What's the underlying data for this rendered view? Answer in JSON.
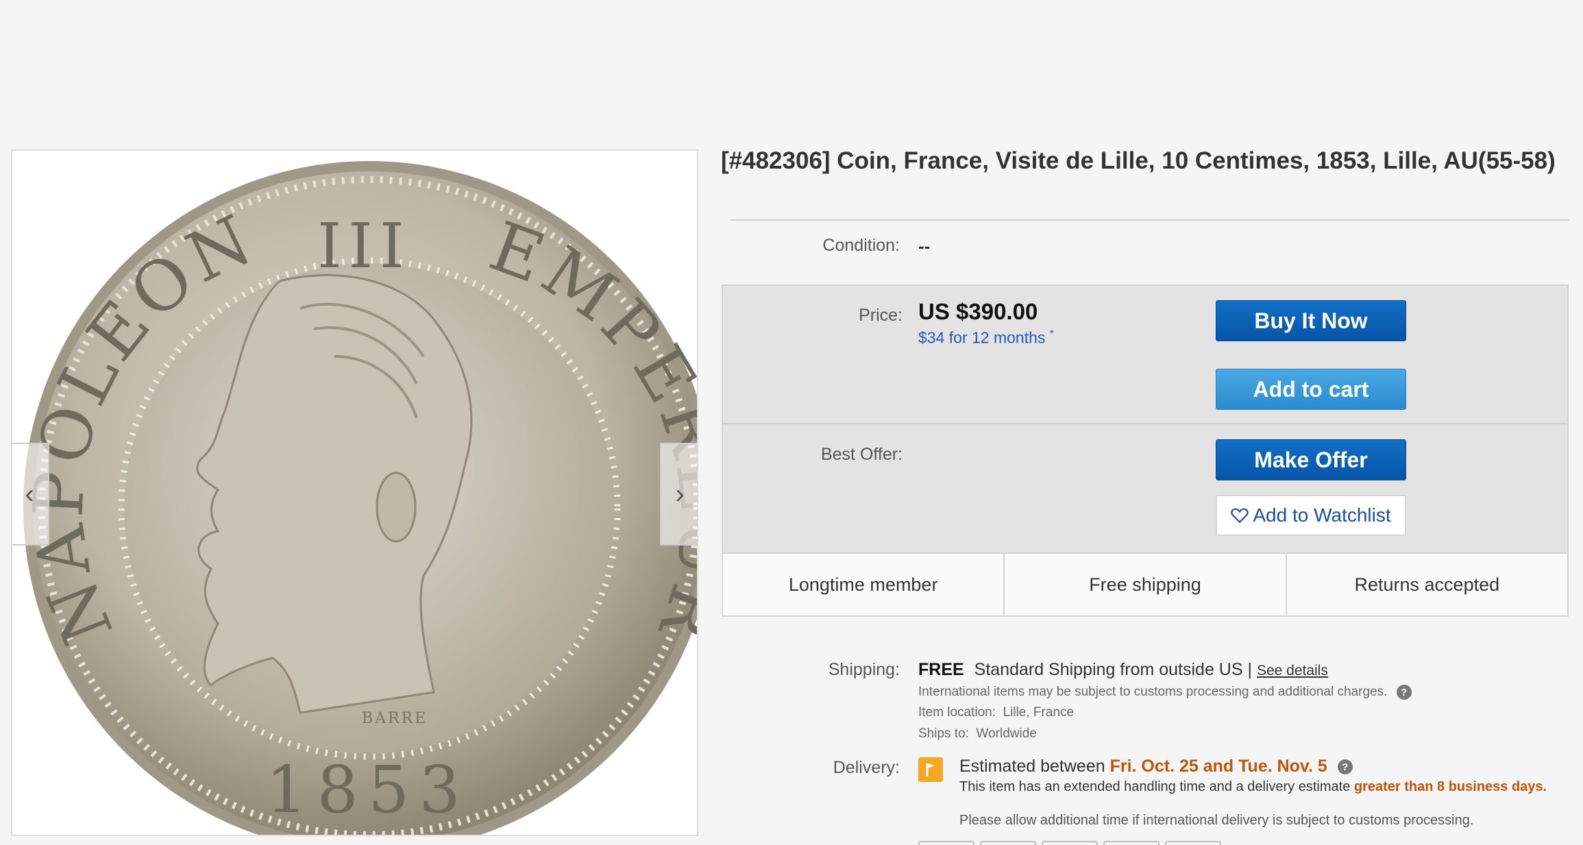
{
  "item": {
    "title": "[#482306] Coin, France, Visite de Lille, 10 Centimes, 1853, Lille, AU(55-58)"
  },
  "viewer": {
    "coin_legend_left": "NAPOLEON",
    "coin_legend_top": "III",
    "coin_legend_right": "EMPEREUR",
    "coin_year": "1853",
    "coin_signature": "BARRE",
    "prev_arrow": "‹",
    "next_arrow": "›"
  },
  "condition": {
    "label": "Condition:",
    "value": "--"
  },
  "pricing": {
    "label": "Price:",
    "price": "US $390.00",
    "financing": "$34 for 12 months",
    "financing_mark": "*",
    "buy_now": "Buy It Now",
    "add_to_cart": "Add to cart"
  },
  "offer": {
    "label": "Best Offer:",
    "make_offer": "Make Offer",
    "watchlist": "Add to Watchlist"
  },
  "badges": [
    "Longtime member",
    "Free shipping",
    "Returns accepted"
  ],
  "shipping": {
    "label": "Shipping:",
    "free": "FREE",
    "method": "Standard Shipping from outside US |",
    "details_link": "See details",
    "customs_note": "International items may be subject to customs processing and additional charges.",
    "location_label": "Item location:",
    "location": "Lille, France",
    "ships_to_label": "Ships to:",
    "ships_to": "Worldwide"
  },
  "delivery": {
    "label": "Delivery:",
    "estimated_prefix": "Estimated between",
    "dates": "Fri. Oct. 25 and Tue. Nov. 5",
    "handling_note": "This item has an extended handling time and a delivery estimate",
    "handling_highlight": "greater than 8 business days.",
    "customs_note": "Please allow additional time if international delivery is subject to customs processing."
  },
  "colors": {
    "primary_button": "#0654a8",
    "cart_button": "#2a8bd0",
    "link": "#2457b5",
    "delivery_highlight": "#c0540b",
    "flag": "#f5a623"
  }
}
